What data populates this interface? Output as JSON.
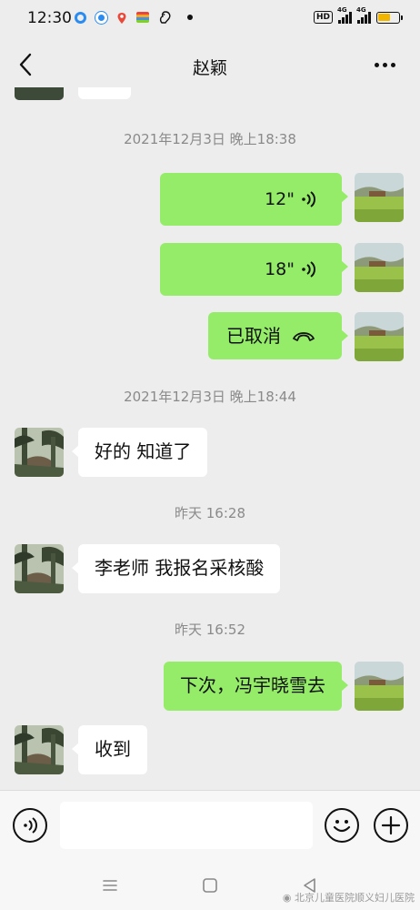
{
  "status_bar": {
    "time": "12:30",
    "network_labels": [
      "HD",
      "4G",
      "4G"
    ],
    "battery_level": 0.62
  },
  "header": {
    "title": "赵颖"
  },
  "messages": [
    {
      "type": "timestamp",
      "text": "2021年12月3日 晚上18:38"
    },
    {
      "type": "voice",
      "side": "out",
      "duration": "12\""
    },
    {
      "type": "voice",
      "side": "out",
      "duration": "18\""
    },
    {
      "type": "call",
      "side": "out",
      "text": "已取消"
    },
    {
      "type": "timestamp",
      "text": "2021年12月3日 晚上18:44"
    },
    {
      "type": "text",
      "side": "in",
      "text": "好的  知道了"
    },
    {
      "type": "timestamp",
      "text": "昨天 16:28"
    },
    {
      "type": "text",
      "side": "in",
      "text": "李老师  我报名采核酸"
    },
    {
      "type": "timestamp",
      "text": "昨天 16:52"
    },
    {
      "type": "text",
      "side": "out",
      "text": "下次，冯宇晓雪去"
    },
    {
      "type": "text",
      "side": "in",
      "text": "收到"
    }
  ],
  "input_bar": {
    "value": "",
    "icons": [
      "voice-input-icon",
      "emoji-icon",
      "plus-icon"
    ]
  },
  "watermark": "北京儿童医院顺义妇儿医院",
  "colors": {
    "outgoing_bubble": "#95ec69",
    "incoming_bubble": "#ffffff",
    "background": "#ededed",
    "timestamp": "#8a8a8a"
  }
}
